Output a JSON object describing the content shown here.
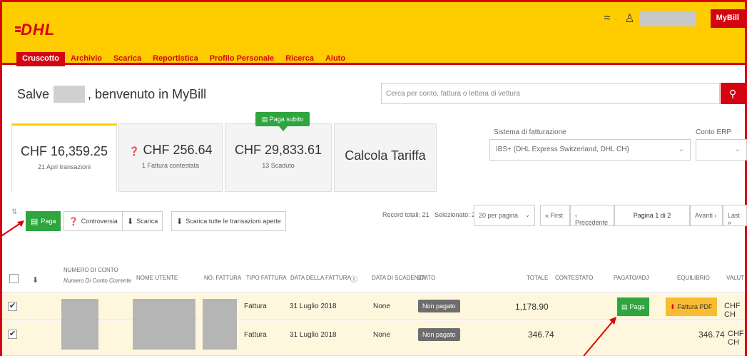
{
  "header": {
    "logo_text": "DHL",
    "icon": "network-icon",
    "separator": "·",
    "user_icon": "user-icon",
    "account_button": "MyBill",
    "brand_color": "#ffcc00",
    "accent_color": "#d40511"
  },
  "nav": {
    "items": [
      "Cruscotto",
      "Archivio",
      "Scarica",
      "Reportistica",
      "Profilo Personale",
      "Ricerca",
      "Aiuto"
    ],
    "active": "Cruscotto"
  },
  "greeting": {
    "prefix": "Salve",
    "suffix": ", benvenuto in MyBill"
  },
  "search": {
    "placeholder": "Cerca per conto, fattura o lettera di vettura",
    "button_icon": "search-icon"
  },
  "cards": [
    {
      "amount": "CHF 16,359.25",
      "sub": "21 Apri transazioni"
    },
    {
      "icon": "question-icon",
      "amount": "CHF 256.64",
      "sub": "1 Fattura contestata"
    },
    {
      "amount": "CHF 29,833.61",
      "sub": "13 Scaduto",
      "tooltip": "Paga subito"
    },
    {
      "label": "Calcola Tariffa"
    }
  ],
  "billing": {
    "label": "Sistema di fatturazione",
    "value": "IBS+ (DHL Express Switzerland, DHL CH)",
    "erp_label": "Conto ERP"
  },
  "toolbar": {
    "pay": "Paga",
    "dispute": "Controversia",
    "download": "Scarica",
    "download_all": "Scarica tutte le transazioni aperte"
  },
  "pager": {
    "records": "Record totali: 21",
    "selected": "Selezionato: 2",
    "per_page": "20 per pagina",
    "first": "« First",
    "prev": "‹ Precedente",
    "page": "Pagina 1 di 2",
    "next": "Avanti ›",
    "last": "Last »"
  },
  "table": {
    "columns": {
      "account": "NUMERO DI CONTO",
      "account_sub": "Numero Di Conto Corrente",
      "user": "NOME UTENTE",
      "invoice_no": "NO. FATTURA",
      "type": "TIPO FATTURA",
      "date": "DATA DELLA FATTURA",
      "due": "DATA DI SCADENZA",
      "status": "STATO",
      "total": "TOTALE",
      "disputed": "CONTESTATO",
      "paid": "PAGATO/ADJ",
      "balance": "EQUILIBRIO",
      "currency": "VALUT"
    },
    "rows": [
      {
        "checked": "✔",
        "type": "Fattura",
        "date": "31 Luglio 2018",
        "due": "None",
        "status": "Non pagato",
        "total": "1,178.90",
        "pay": "Paga",
        "pdf": "Fattura PDF",
        "currency": "CHF CH"
      },
      {
        "checked": "✔",
        "type": "Fattura",
        "date": "31 Luglio 2018",
        "due": "None",
        "status": "Non pagato",
        "total": "346.74",
        "balance": "346.74",
        "currency": "CHF CH"
      }
    ]
  }
}
